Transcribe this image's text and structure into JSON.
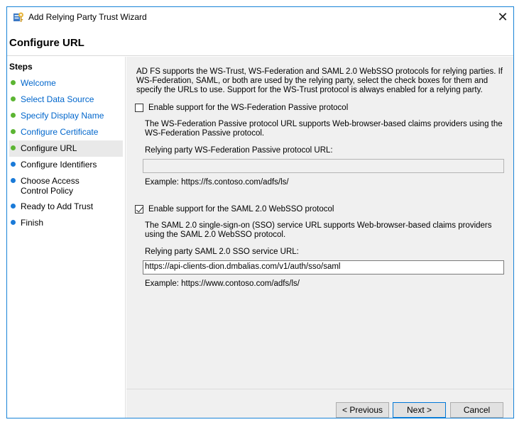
{
  "window": {
    "title": "Add Relying Party Trust Wizard",
    "close_glyph": "✕"
  },
  "header": {
    "title": "Configure URL"
  },
  "sidebar": {
    "title": "Steps",
    "items": [
      {
        "label": "Welcome",
        "state": "done"
      },
      {
        "label": "Select Data Source",
        "state": "done"
      },
      {
        "label": "Specify Display Name",
        "state": "done"
      },
      {
        "label": "Configure Certificate",
        "state": "done"
      },
      {
        "label": "Configure URL",
        "state": "current"
      },
      {
        "label": "Configure Identifiers",
        "state": "todo"
      },
      {
        "label": "Choose Access Control Policy",
        "state": "todo"
      },
      {
        "label": "Ready to Add Trust",
        "state": "todo"
      },
      {
        "label": "Finish",
        "state": "todo"
      }
    ]
  },
  "main": {
    "intro": "AD FS supports the WS-Trust, WS-Federation and SAML 2.0 WebSSO protocols for relying parties.  If WS-Federation, SAML, or both are used by the relying party, select the check boxes for them and specify the URLs to use.  Support for the WS-Trust protocol is always enabled for a relying party.",
    "wsfed": {
      "checkbox_label": "Enable support for the WS-Federation Passive protocol",
      "checked": false,
      "description": "The WS-Federation Passive protocol URL supports Web-browser-based claims providers using the WS-Federation Passive protocol.",
      "field_label": "Relying party WS-Federation Passive protocol URL:",
      "value": "",
      "example": "Example: https://fs.contoso.com/adfs/ls/"
    },
    "saml": {
      "checkbox_label": "Enable support for the SAML 2.0 WebSSO protocol",
      "checked": true,
      "description": "The SAML 2.0 single-sign-on (SSO) service URL supports Web-browser-based claims providers using the SAML 2.0 WebSSO protocol.",
      "field_label": "Relying party SAML 2.0 SSO service URL:",
      "value": "https://api-clients-dion.dmbalias.com/v1/auth/sso/saml",
      "example": "Example: https://www.contoso.com/adfs/ls/"
    }
  },
  "footer": {
    "previous_label": "< Previous",
    "next_label": "Next >",
    "cancel_label": "Cancel"
  }
}
